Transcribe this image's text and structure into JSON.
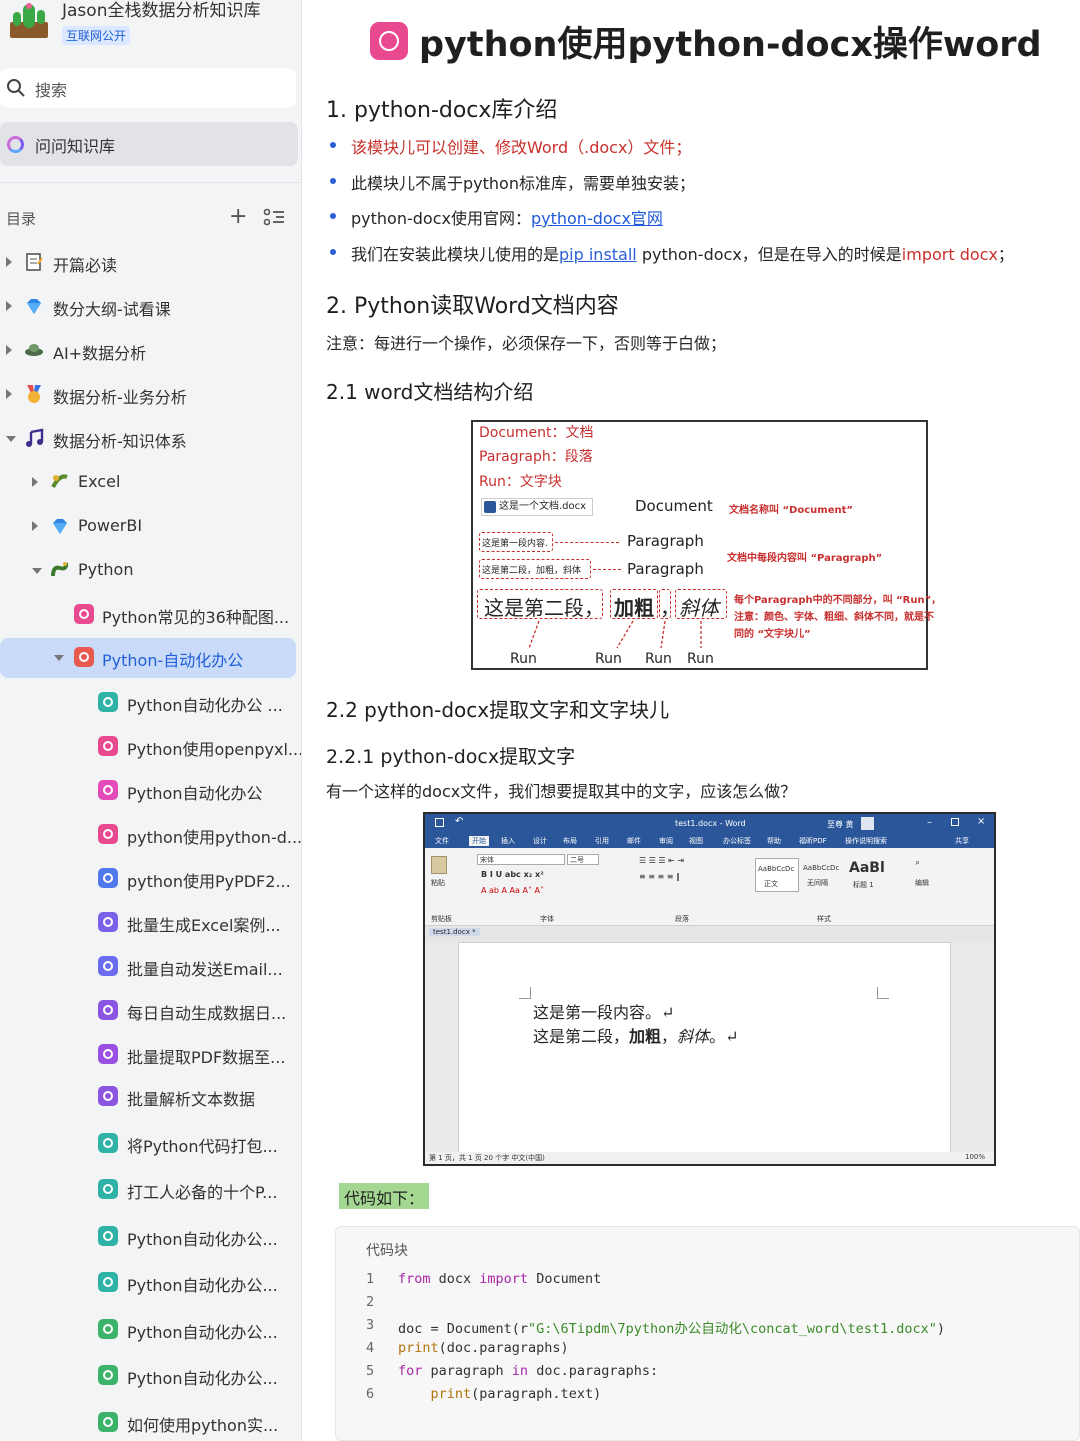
{
  "sidebar": {
    "kb_title": "Jason全栈数据分析知识库",
    "kb_badge": "互联网公开",
    "search_label": "搜索",
    "ask_label": "问问知识库",
    "toc_label": "目录",
    "toc_add": "+",
    "items": [
      {
        "label": "开篇必读",
        "icon": "notebook-icon"
      },
      {
        "label": "数分大纲-试看课",
        "icon": "diamond-icon"
      },
      {
        "label": "AI+数据分析",
        "icon": "ufo-icon"
      },
      {
        "label": "数据分析-业务分析",
        "icon": "medal-icon"
      },
      {
        "label": "数据分析-知识体系",
        "icon": "music-icon"
      },
      {
        "label": "Excel",
        "icon": "excel-icon"
      },
      {
        "label": "PowerBI",
        "icon": "diamond-icon"
      },
      {
        "label": "Python",
        "icon": "python-icon"
      },
      {
        "label": "Python常见的36种配图...",
        "icon": "doc-icon",
        "color": "#e8498f"
      },
      {
        "label": "Python-自动化办公",
        "icon": "doc-icon",
        "color": "#e85a4f"
      },
      {
        "label": "Python自动化办公 ...",
        "icon": "doc-icon",
        "color": "#2fb3a6"
      },
      {
        "label": "Python使用openpyxl...",
        "icon": "doc-icon",
        "color": "#e8498f"
      },
      {
        "label": "Python自动化办公",
        "icon": "doc-icon",
        "color": "#e24bb8"
      },
      {
        "label": "python使用python-d...",
        "icon": "doc-icon",
        "color": "#e8498f"
      },
      {
        "label": "python使用PyPDF2...",
        "icon": "doc-icon",
        "color": "#4f78ea"
      },
      {
        "label": "批量生成Excel案例...",
        "icon": "doc-icon",
        "color": "#7b61e8"
      },
      {
        "label": "批量自动发送Email...",
        "icon": "doc-icon",
        "color": "#6b6cf0"
      },
      {
        "label": "每日自动生成数据日...",
        "icon": "doc-icon",
        "color": "#8a55e0"
      },
      {
        "label": "批量提取PDF数据至...",
        "icon": "doc-icon",
        "color": "#9a50e0"
      },
      {
        "label": "批量解析文本数据",
        "icon": "doc-icon",
        "color": "#8a55e0"
      },
      {
        "label": "将Python代码打包...",
        "icon": "doc-icon",
        "color": "#2fb3a6"
      },
      {
        "label": "打工人必备的十个P...",
        "icon": "doc-icon",
        "color": "#2fb3a6"
      },
      {
        "label": "Python自动化办公...",
        "icon": "doc-icon",
        "color": "#2fb3a6"
      },
      {
        "label": "Python自动化办公...",
        "icon": "doc-icon",
        "color": "#2fb3a6"
      },
      {
        "label": "Python自动化办公...",
        "icon": "doc-icon",
        "color": "#3bb36a"
      },
      {
        "label": "Python自动化办公...",
        "icon": "doc-icon",
        "color": "#3bb36a"
      },
      {
        "label": "如何使用python实...",
        "icon": "doc-icon",
        "color": "#3bb36a"
      }
    ]
  },
  "doc": {
    "title": "python使用python-docx操作word",
    "s1_heading": "1. python-docx库介绍",
    "s1_b1": "该模块儿可以创建、修改Word（.docx）文件；",
    "s1_b2": "此模块儿不属于python标准库，需要单独安装；",
    "s1_b3_pre": "python-docx使用官网：",
    "s1_b3_link": "python-docx官网",
    "s1_b4_pre": "我们在安装此模块儿使用的是",
    "s1_b4_pip": "pip install",
    "s1_b4_mid": " python-docx，但是在导入的时候是",
    "s1_b4_import": "import docx",
    "s1_b4_end": "；",
    "s2_heading": "2. Python读取Word文档内容",
    "s2_note": "注意：每进行一个操作，必须保存一下，否则等于白做；",
    "s21_heading": "2.1 word文档结构介绍",
    "s22_heading": "2.2 python-docx提取文字和文字块儿",
    "s221_heading": "2.2.1 python-docx提取文字",
    "s221_para": "有一个这样的docx文件，我们想要提取其中的文字，应该怎么做？",
    "code_hint": "代码如下：",
    "code_label": "代码块"
  },
  "diagram": {
    "legend1": "Document：文档",
    "legend2": "Paragraph：段落",
    "legend3": "Run：文字块",
    "file_name": "这是一个文档.docx",
    "document": "Document",
    "document_note": "文档名称叫 “Document”",
    "para1_box": "这是第一段内容.",
    "para2_box": "这是第二段，加粗，斜体",
    "paragraph": "Paragraph",
    "paragraph_note": "文档中每段内容叫 “Paragraph”",
    "run1": "这是第二段，",
    "run2": "加粗",
    "run3": "，",
    "run4": "斜体",
    "run_note1": "每个Paragraph中的不同部分，叫 “Run”，",
    "run_note2": "注意：颜色、字体、粗细、斜体不同，就是不",
    "run_note3": "同的 “文字块儿”",
    "run_label": "Run"
  },
  "word": {
    "window_title": "test1.docx  -  Word",
    "user": "至尊 黄",
    "tabs": [
      "文件",
      "开始",
      "插入",
      "设计",
      "布局",
      "引用",
      "邮件",
      "审阅",
      "视图",
      "办公标签",
      "帮助",
      "福昕PDF",
      "操作说明搜索",
      "共享"
    ],
    "font_name": "宋体",
    "font_size": "二号",
    "groups": [
      "剪贴板",
      "字体",
      "段落",
      "样式",
      "编辑"
    ],
    "paste": "粘贴",
    "styles": [
      "AaBbCcDc",
      "AaBbCcDc",
      "AaBl"
    ],
    "style_names": [
      "正文",
      "无间隔",
      "标题 1"
    ],
    "doc_tab": "test1.docx *",
    "line1": "这是第一段内容。↵",
    "line2_a": "这是第二段，",
    "line2_b": "加粗",
    "line2_c": "，",
    "line2_d": "斜体",
    "line2_e": "。↵",
    "status": "第 1 页，共 1 页    20 个字    中文(中国)",
    "zoom": "100%"
  },
  "code": [
    {
      "n": "1",
      "parts": [
        [
          "kw",
          "from"
        ],
        [
          "",
          " docx "
        ],
        [
          "kw",
          "import"
        ],
        [
          "",
          " Document"
        ]
      ]
    },
    {
      "n": "2",
      "parts": []
    },
    {
      "n": "3",
      "parts": [
        [
          "",
          "doc = Document(r"
        ],
        [
          "str",
          "\"G:\\6Tipdm\\7python办公自动化\\concat_word\\test1.docx\""
        ],
        [
          "",
          ")"
        ]
      ]
    },
    {
      "n": "4",
      "parts": [
        [
          "fn",
          "print"
        ],
        [
          "",
          "(doc.paragraphs)"
        ]
      ]
    },
    {
      "n": "5",
      "parts": [
        [
          "kw",
          "for"
        ],
        [
          "",
          " paragraph "
        ],
        [
          "kw",
          "in"
        ],
        [
          "",
          " doc.paragraphs:"
        ]
      ]
    },
    {
      "n": "6",
      "parts": [
        [
          "",
          "    "
        ],
        [
          "fn",
          "print"
        ],
        [
          "",
          "(paragraph.text)"
        ]
      ]
    }
  ]
}
